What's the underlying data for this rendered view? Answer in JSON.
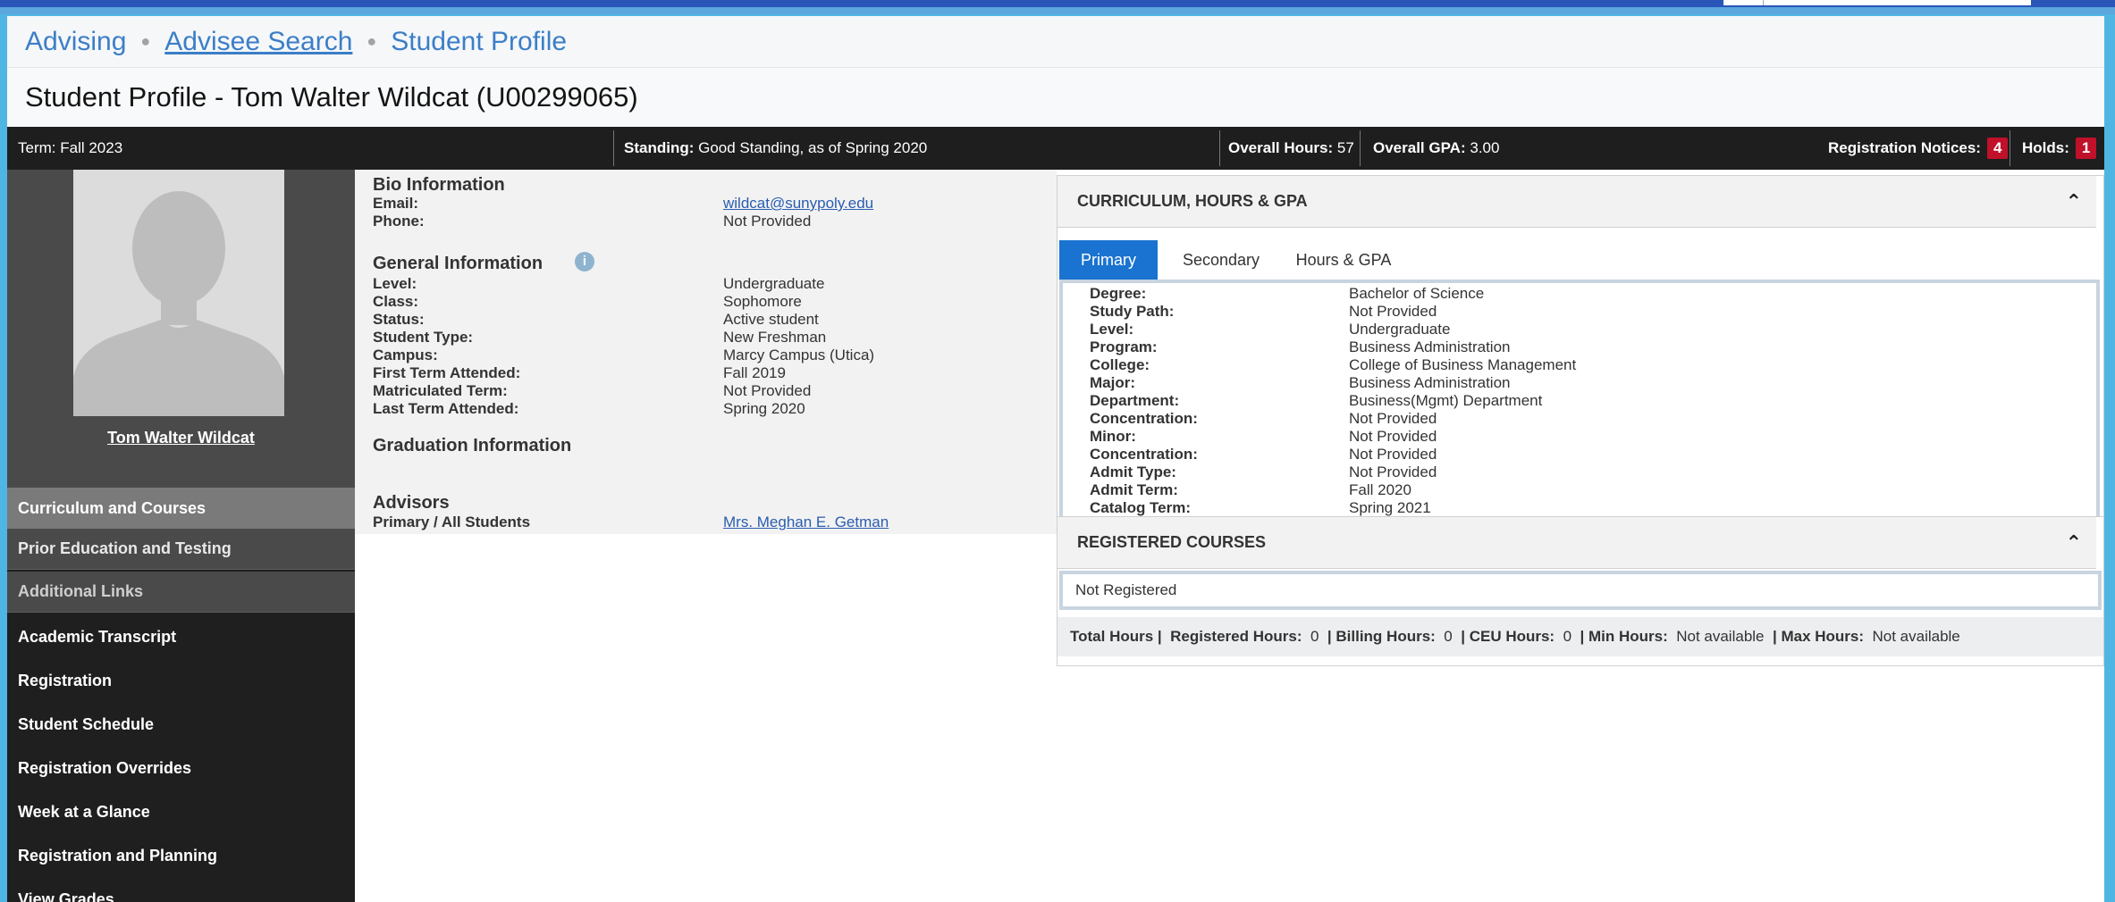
{
  "breadcrumb": {
    "advising": "Advising",
    "advisee_search": "Advisee Search",
    "student_profile": "Student Profile"
  },
  "title": "Student Profile - Tom Walter Wildcat (U00299065)",
  "status": {
    "term_label": "Term:",
    "term_value": "Fall 2023",
    "standing_label": "Standing:",
    "standing_value": "Good Standing, as of Spring 2020",
    "hours_label": "Overall Hours:",
    "hours_value": "57",
    "gpa_label": "Overall GPA:",
    "gpa_value": "3.00",
    "notices_label": "Registration Notices:",
    "notices_count": "4",
    "holds_label": "Holds:",
    "holds_count": "1"
  },
  "sidebar": {
    "student_name": "Tom Walter Wildcat",
    "items": [
      "Curriculum and Courses",
      "Prior Education and Testing",
      "Additional Links",
      "Academic Transcript",
      "Registration",
      "Student Schedule",
      "Registration Overrides",
      "Week at a Glance",
      "Registration and Planning",
      "View Grades"
    ]
  },
  "bio": {
    "heading": "Bio Information",
    "email_label": "Email:",
    "email_value": "wildcat@sunypoly.edu",
    "phone_label": "Phone:",
    "phone_value": "Not Provided"
  },
  "general": {
    "heading": "General Information",
    "info_icon": "info-icon",
    "rows": [
      {
        "label": "Level:",
        "value": "Undergraduate"
      },
      {
        "label": "Class:",
        "value": "Sophomore"
      },
      {
        "label": "Status:",
        "value": "Active student"
      },
      {
        "label": "Student Type:",
        "value": "New Freshman"
      },
      {
        "label": "Campus:",
        "value": "Marcy Campus (Utica)"
      },
      {
        "label": "First Term Attended:",
        "value": "Fall 2019"
      },
      {
        "label": "Matriculated Term:",
        "value": "Not Provided"
      },
      {
        "label": "Last Term Attended:",
        "value": "Spring 2020"
      }
    ]
  },
  "graduation": {
    "heading": "Graduation Information"
  },
  "advisors": {
    "heading": "Advisors",
    "label": "Primary / All Students",
    "value": "Mrs. Meghan E. Getman"
  },
  "curriculum": {
    "heading": "CURRICULUM, HOURS & GPA",
    "tabs": [
      "Primary",
      "Secondary",
      "Hours & GPA"
    ],
    "rows": [
      {
        "label": "Degree:",
        "value": "Bachelor of Science"
      },
      {
        "label": "Study Path:",
        "value": "Not Provided"
      },
      {
        "label": "Level:",
        "value": "Undergraduate"
      },
      {
        "label": "Program:",
        "value": "Business Administration"
      },
      {
        "label": "College:",
        "value": "College of Business Management"
      },
      {
        "label": "Major:",
        "value": "Business Administration"
      },
      {
        "label": "Department:",
        "value": "Business(Mgmt) Department"
      },
      {
        "label": "Concentration:",
        "value": "Not Provided"
      },
      {
        "label": "Minor:",
        "value": "Not Provided"
      },
      {
        "label": "Concentration:",
        "value": "Not Provided"
      },
      {
        "label": "Admit Type:",
        "value": "Not Provided"
      },
      {
        "label": "Admit Term:",
        "value": "Fall 2020"
      },
      {
        "label": "Catalog Term:",
        "value": "Spring 2021"
      }
    ]
  },
  "registered": {
    "heading": "REGISTERED COURSES",
    "empty_text": "Not Registered",
    "total_hours_label": "Total Hours |",
    "registered_label": "Registered Hours:",
    "registered_value": "0",
    "billing_label": "Billing Hours:",
    "billing_value": "0",
    "ceu_label": "CEU Hours:",
    "ceu_value": "0",
    "min_label": "Min Hours:",
    "min_value": "Not available",
    "max_label": "Max Hours:",
    "max_value": "Not available",
    "sep": "|"
  },
  "colors": {
    "accent": "#1a73d0",
    "dark": "#1e1e1e",
    "badge": "#c0102a",
    "link": "#3c7ec7"
  }
}
